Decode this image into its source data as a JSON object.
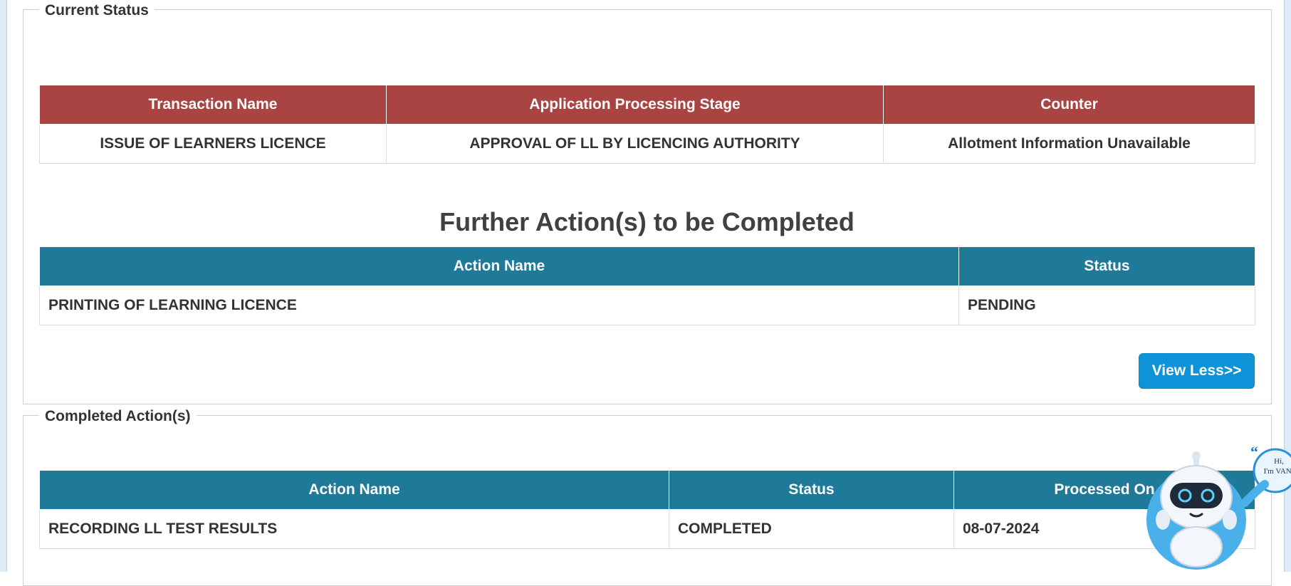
{
  "current_status": {
    "legend": "Current Status",
    "columns": [
      "Transaction Name",
      "Application Processing Stage",
      "Counter"
    ],
    "row": [
      "ISSUE OF LEARNERS LICENCE",
      "APPROVAL OF LL BY LICENCING AUTHORITY",
      "Allotment Information Unavailable"
    ],
    "colors": {
      "header_bg": "#a94442"
    }
  },
  "further_actions": {
    "heading": "Further Action(s) to be Completed",
    "columns": [
      "Action Name",
      "Status"
    ],
    "row": [
      "PRINTING OF LEARNING LICENCE",
      "PENDING"
    ],
    "colors": {
      "header_bg": "#1f7a99"
    }
  },
  "view_less_button": {
    "label": "View Less>>",
    "color": "#0e93d8"
  },
  "completed_actions": {
    "legend": "Completed Action(s)",
    "columns": [
      "Action Name",
      "Status",
      "Processed On"
    ],
    "row": [
      "RECORDING LL TEST RESULTS",
      "COMPLETED",
      "08-07-2024"
    ]
  },
  "chatbot": {
    "icon": "robot-assistant-icon",
    "bubble_line1": "Hi,",
    "bubble_line2": "I'm VANI"
  }
}
